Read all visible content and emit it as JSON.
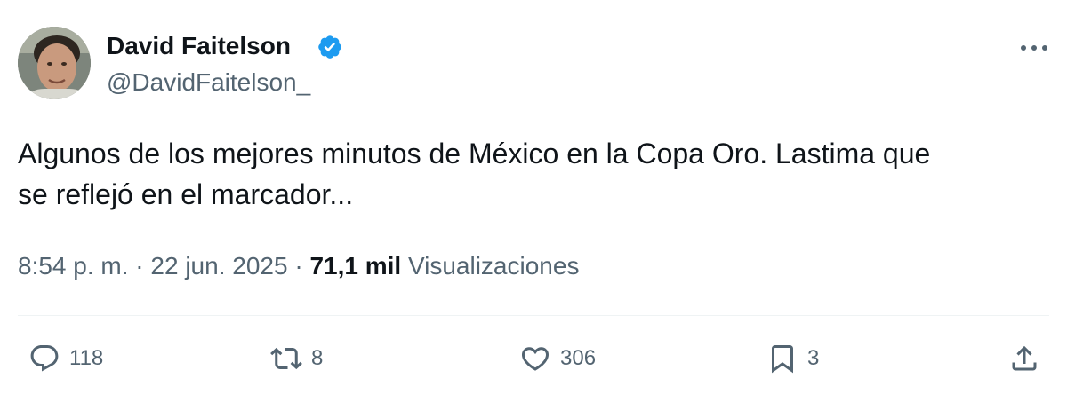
{
  "author": {
    "display_name": "David Faitelson",
    "handle": "@DavidFaitelson_",
    "verified": true,
    "verified_color": "#1d9bf0"
  },
  "tweet": {
    "text_line1": "Algunos de los mejores minutos de México en la Copa Oro. Lastima que",
    "text_line2": "se reflejó en el marcador..."
  },
  "meta": {
    "time": "8:54 p. m.",
    "separator": " · ",
    "date": "22 jun. 2025",
    "views_count": "71,1 mil",
    "views_label": "Visualizaciones"
  },
  "actions": {
    "reply_count": "118",
    "retweet_count": "8",
    "like_count": "306",
    "bookmark_count": "3"
  },
  "icons": {
    "more": "more-dots-icon",
    "reply": "reply-icon",
    "retweet": "retweet-icon",
    "like": "heart-icon",
    "bookmark": "bookmark-icon",
    "share": "share-icon"
  },
  "colors": {
    "text": "#0f1419",
    "secondary": "#536471",
    "divider": "#eff3f4"
  }
}
